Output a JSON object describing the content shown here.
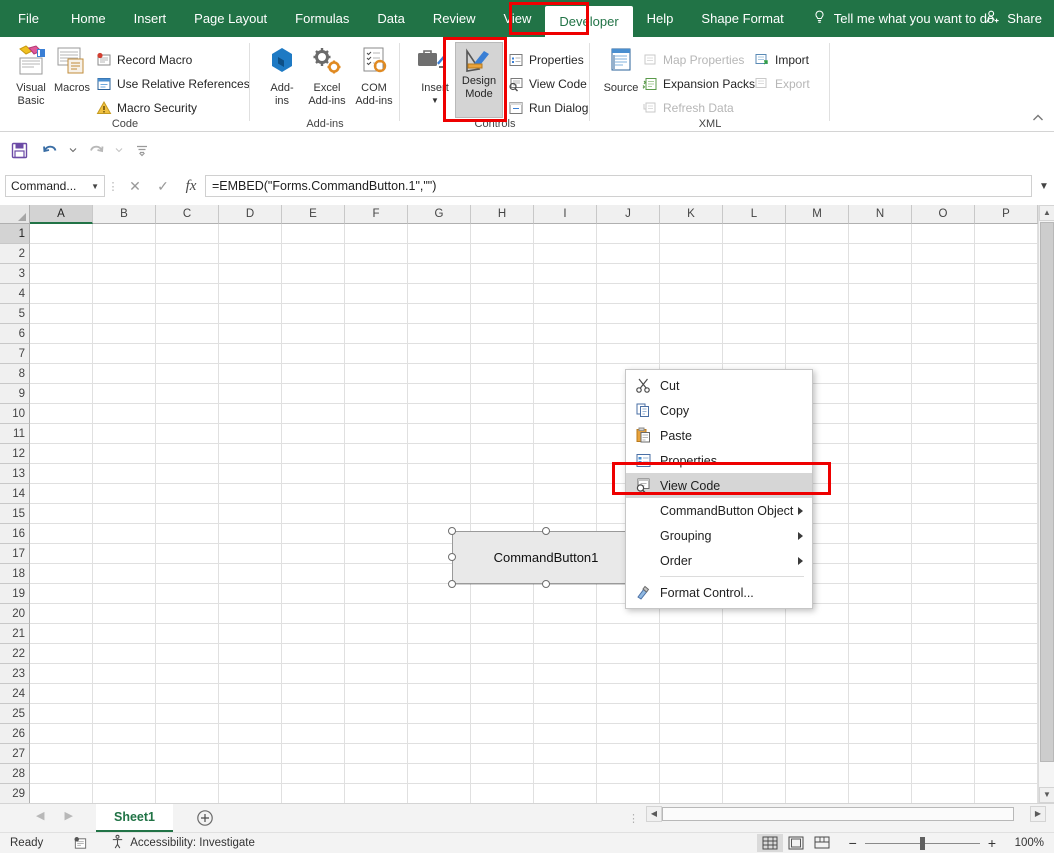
{
  "ribbon": {
    "tabs": [
      {
        "label": "File",
        "active": false
      },
      {
        "label": "Home",
        "active": false
      },
      {
        "label": "Insert",
        "active": false
      },
      {
        "label": "Page Layout",
        "active": false
      },
      {
        "label": "Formulas",
        "active": false
      },
      {
        "label": "Data",
        "active": false
      },
      {
        "label": "Review",
        "active": false
      },
      {
        "label": "View",
        "active": false
      },
      {
        "label": "Developer",
        "active": true
      },
      {
        "label": "Help",
        "active": false
      },
      {
        "label": "Shape Format",
        "active": false
      }
    ],
    "tellme": "Tell me what you want to do",
    "tellme_icon": "lightbulb-icon",
    "share": "Share",
    "share_icon": "share-person-icon",
    "groups": {
      "code": {
        "label": "Code",
        "visual_basic": "Visual\nBasic",
        "visual_basic_line1": "Visual",
        "visual_basic_line2": "Basic",
        "macros": "Macros",
        "record_macro": "Record Macro",
        "use_relative_references": "Use Relative References",
        "macro_security": "Macro Security"
      },
      "addins": {
        "label": "Add-ins",
        "add_ins_line1": "Add-",
        "add_ins_line2": "ins",
        "excel_add_ins_line1": "Excel",
        "excel_add_ins_line2": "Add-ins",
        "com_add_ins_line1": "COM",
        "com_add_ins_line2": "Add-ins"
      },
      "controls": {
        "label": "Controls",
        "insert": "Insert",
        "design_mode_line1": "Design",
        "design_mode_line2": "Mode",
        "properties": "Properties",
        "view_code": "View Code",
        "run_dialog": "Run Dialog"
      },
      "xml": {
        "label": "XML",
        "source": "Source",
        "map_properties": "Map Properties",
        "expansion_packs": "Expansion Packs",
        "refresh_data": "Refresh Data",
        "import": "Import",
        "export": "Export"
      }
    },
    "collapse_icon": "chevron-up-icon"
  },
  "qat": {
    "save_icon": "save-icon",
    "undo_icon": "undo-icon",
    "redo_icon": "redo-icon",
    "customize_icon": "customize-qat-icon"
  },
  "formula_bar": {
    "name_box_value": "Command...",
    "name_box_dropdown_icon": "chevron-down-icon",
    "cancel_icon": "cancel-icon",
    "enter_icon": "check-icon",
    "fx_icon": "fx-icon",
    "formula": "=EMBED(\"Forms.CommandButton.1\",\"\")",
    "expand_icon": "chevron-down-icon"
  },
  "grid": {
    "columns": [
      "A",
      "B",
      "C",
      "D",
      "E",
      "F",
      "G",
      "H",
      "I",
      "J",
      "K",
      "L",
      "M",
      "N",
      "O",
      "P"
    ],
    "selected_column": "A",
    "rows": [
      1,
      2,
      3,
      4,
      5,
      6,
      7,
      8,
      9,
      10,
      11,
      12,
      13,
      14,
      15,
      16,
      17,
      18,
      19,
      20,
      21,
      22,
      23,
      24,
      25,
      26,
      27,
      28,
      29
    ],
    "selected_row": 1,
    "select_all_icon": "select-all-corner-icon"
  },
  "command_button": {
    "caption": "CommandButton1",
    "selected": true
  },
  "context_menu": {
    "items": [
      {
        "label": "Cut",
        "icon": "scissors-icon",
        "submenu": false,
        "highlighted": false,
        "accel_index": 2
      },
      {
        "label": "Copy",
        "icon": "copy-icon",
        "submenu": false,
        "highlighted": false,
        "accel_index": 1
      },
      {
        "label": "Paste",
        "icon": "paste-icon",
        "submenu": false,
        "highlighted": false,
        "accel_index": 1
      },
      {
        "label": "Properties",
        "icon": "properties-icon",
        "submenu": false,
        "highlighted": false,
        "accel_index": 1
      },
      {
        "label": "View Code",
        "icon": "view-code-icon",
        "submenu": false,
        "highlighted": true,
        "accel_index": 1
      },
      {
        "label": "CommandButton Object",
        "icon": "none",
        "submenu": true,
        "highlighted": false,
        "accel_index": 15
      },
      {
        "label": "Grouping",
        "icon": "none",
        "submenu": true,
        "highlighted": false,
        "accel_index": 1
      },
      {
        "label": "Order",
        "icon": "none",
        "submenu": true,
        "highlighted": false,
        "accel_index": 2
      },
      {
        "label": "Format Control...",
        "icon": "format-control-icon",
        "submenu": false,
        "highlighted": false,
        "accel_index": 1
      }
    ]
  },
  "sheet_bar": {
    "prev_icon": "nav-left-icon",
    "next_icon": "nav-right-icon",
    "tabs": [
      {
        "label": "Sheet1",
        "active": true
      }
    ],
    "add_sheet_icon": "plus-circle-icon"
  },
  "status_bar": {
    "state": "Ready",
    "macro_record_icon": "record-macro-status-icon",
    "accessibility_icon": "accessibility-icon",
    "accessibility": "Accessibility: Investigate",
    "view_normal_icon": "normal-view-icon",
    "view_pagelayout_icon": "page-layout-view-icon",
    "view_pagebreak_icon": "page-break-view-icon",
    "zoom_out_icon": "minus-icon",
    "zoom_in_icon": "plus-icon",
    "zoom_level": "100%"
  },
  "highlights": {
    "color": "#ee0000",
    "boxes": [
      "developer-tab",
      "design-mode-button",
      "view-code-menu-item"
    ]
  },
  "colors": {
    "excel_green": "#217346",
    "ribbon_bg": "#ffffff",
    "highlight_red": "#ee0000",
    "menu_highlight": "#d6d6d6"
  }
}
